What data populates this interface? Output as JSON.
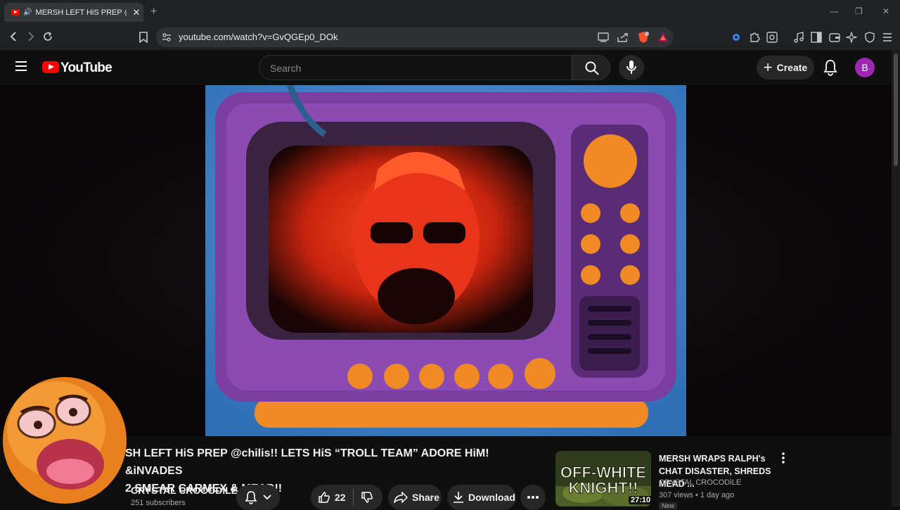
{
  "browser": {
    "tab_title": "MERSH LEFT HiS PREP @chilis!! LETS HiS",
    "new_tab": "+",
    "url": "youtube.com/watch?v=GvQGEp0_DOk"
  },
  "header": {
    "logo_text": "YouTube",
    "search_placeholder": "Search",
    "create_label": "Create",
    "avatar_letter": "B"
  },
  "video": {
    "title_line1": "SH LEFT HiS PREP @chilis!! LETS HiS “TROLL TEAM” ADORE HiM! &iNVADES",
    "title_line2": "2 SMEAR CARMEX & MEAD!!",
    "channel": "CRYSTAL CROCODiLE",
    "subscribers": "251 subscribers",
    "likes": "22",
    "share_label": "Share",
    "download_label": "Download"
  },
  "recommendation": {
    "thumb_text_1": "OFF-WHITE",
    "thumb_text_2": "KNIGHT!!",
    "duration": "27:10",
    "title": "MERSH WRAPS RALPH's CHAT DISASTER, SHREDS MEAD ...",
    "channel": "CRYSTAL CROCODiLE",
    "meta": "307 views • 1 day ago",
    "badge": "New"
  },
  "colors": {
    "background": "#0f0f0f",
    "accent_red": "#ff0000",
    "tv_purple": "#7b3fa0",
    "tv_orange": "#f08a24",
    "screen_red": "#e8341a",
    "avatar": "#9c27b0"
  }
}
